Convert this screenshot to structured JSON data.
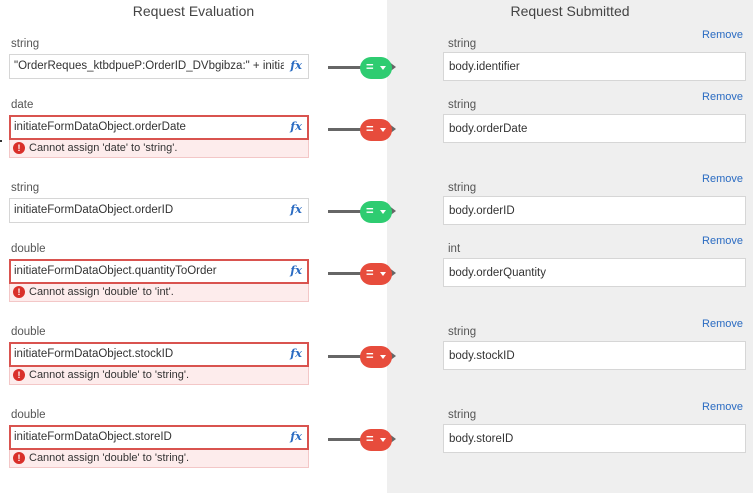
{
  "headers": {
    "left": "Request Evaluation",
    "right": "Request Submitted"
  },
  "rows": [
    {
      "source_type": "string",
      "expression": "\"OrderReques_ktbdpueP:OrderID_DVbgibza:\" + initia",
      "status": "match",
      "error": "",
      "target_type": "string",
      "target": "body.identifier",
      "remove": "Remove"
    },
    {
      "source_type": "date",
      "expression": "initiateFormDataObject.orderDate",
      "status": "mismatch",
      "error": "Cannot assign 'date' to 'string'.",
      "target_type": "string",
      "target": "body.orderDate",
      "remove": "Remove"
    },
    {
      "source_type": "string",
      "expression": "initiateFormDataObject.orderID",
      "status": "match",
      "error": "",
      "target_type": "string",
      "target": "body.orderID",
      "remove": "Remove"
    },
    {
      "source_type": "double",
      "expression": "initiateFormDataObject.quantityToOrder",
      "status": "mismatch",
      "error": "Cannot assign 'double' to 'int'.",
      "target_type": "int",
      "target": "body.orderQuantity",
      "remove": "Remove"
    },
    {
      "source_type": "double",
      "expression": "initiateFormDataObject.stockID",
      "status": "mismatch",
      "error": "Cannot assign 'double' to 'string'.",
      "target_type": "string",
      "target": "body.stockID",
      "remove": "Remove"
    },
    {
      "source_type": "double",
      "expression": "initiateFormDataObject.storeID",
      "status": "mismatch",
      "error": "Cannot assign 'double' to 'string'.",
      "target_type": "string",
      "target": "body.storeID",
      "remove": "Remove"
    }
  ],
  "icons": {
    "function": "fx-icon",
    "error": "exclamation-circle-icon",
    "match": "equals-dropdown-icon"
  },
  "colors": {
    "match": "#2ecc71",
    "mismatch": "#e74c3c",
    "error_border": "#d9534f",
    "link": "#2a6bc2",
    "right_panel_bg": "#efefef"
  }
}
